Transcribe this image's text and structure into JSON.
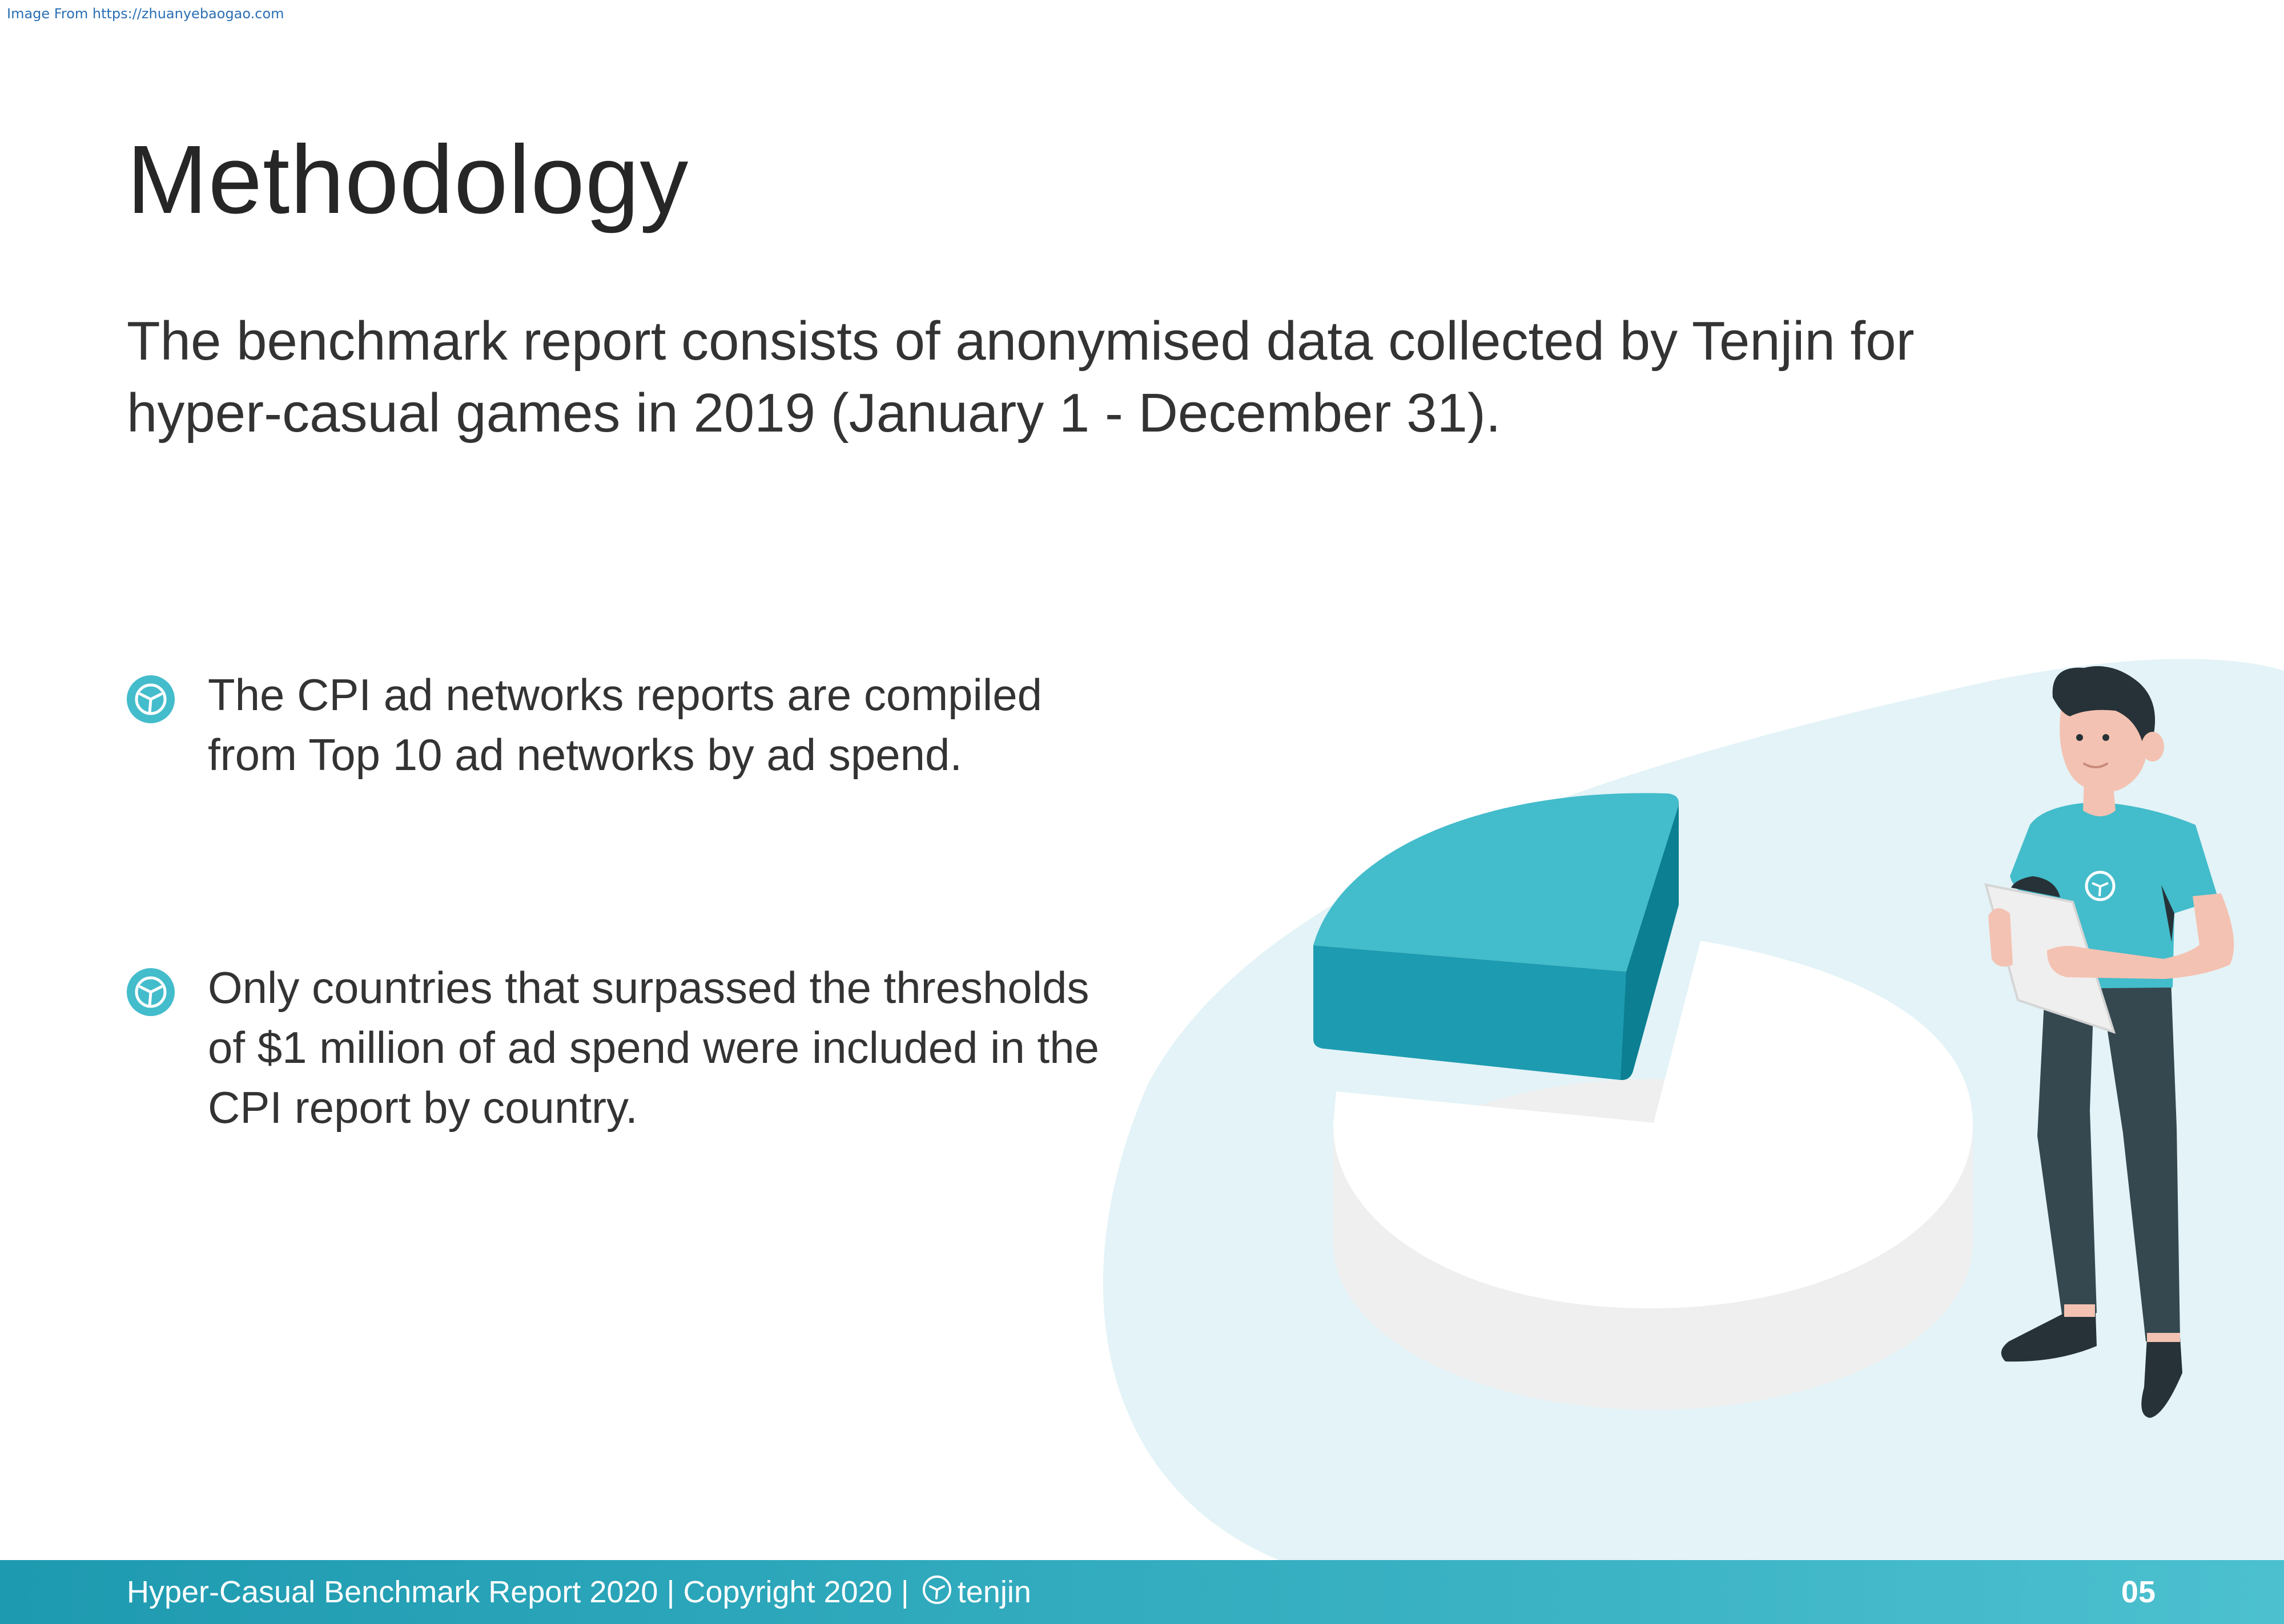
{
  "watermark": "Image From https://zhuanyebaogao.com",
  "page": {
    "title": "Methodology",
    "intro": "The benchmark report consists of anonymised data collected by Tenjin for hyper-casual games in 2019 (January 1 - December 31)."
  },
  "bullets": [
    {
      "icon": "tenjin-logo-icon",
      "text": "The CPI ad networks reports are compiled from Top 10 ad networks by ad spend."
    },
    {
      "icon": "tenjin-logo-icon",
      "text": "Only countries that surpassed the thresholds of $1 million of ad spend were included in the CPI report by country."
    }
  ],
  "footer": {
    "text": "Hyper-Casual Benchmark Report 2020 | Copyright 2020 |",
    "brand": "tenjin",
    "page_number": "05"
  },
  "colors": {
    "accent": "#43bccb",
    "accent_dark": "#1d9bb0",
    "background_blob": "#e3f3f7",
    "footer_start": "#1e9ab0",
    "footer_end": "#4cc0cf",
    "text": "#333333"
  }
}
